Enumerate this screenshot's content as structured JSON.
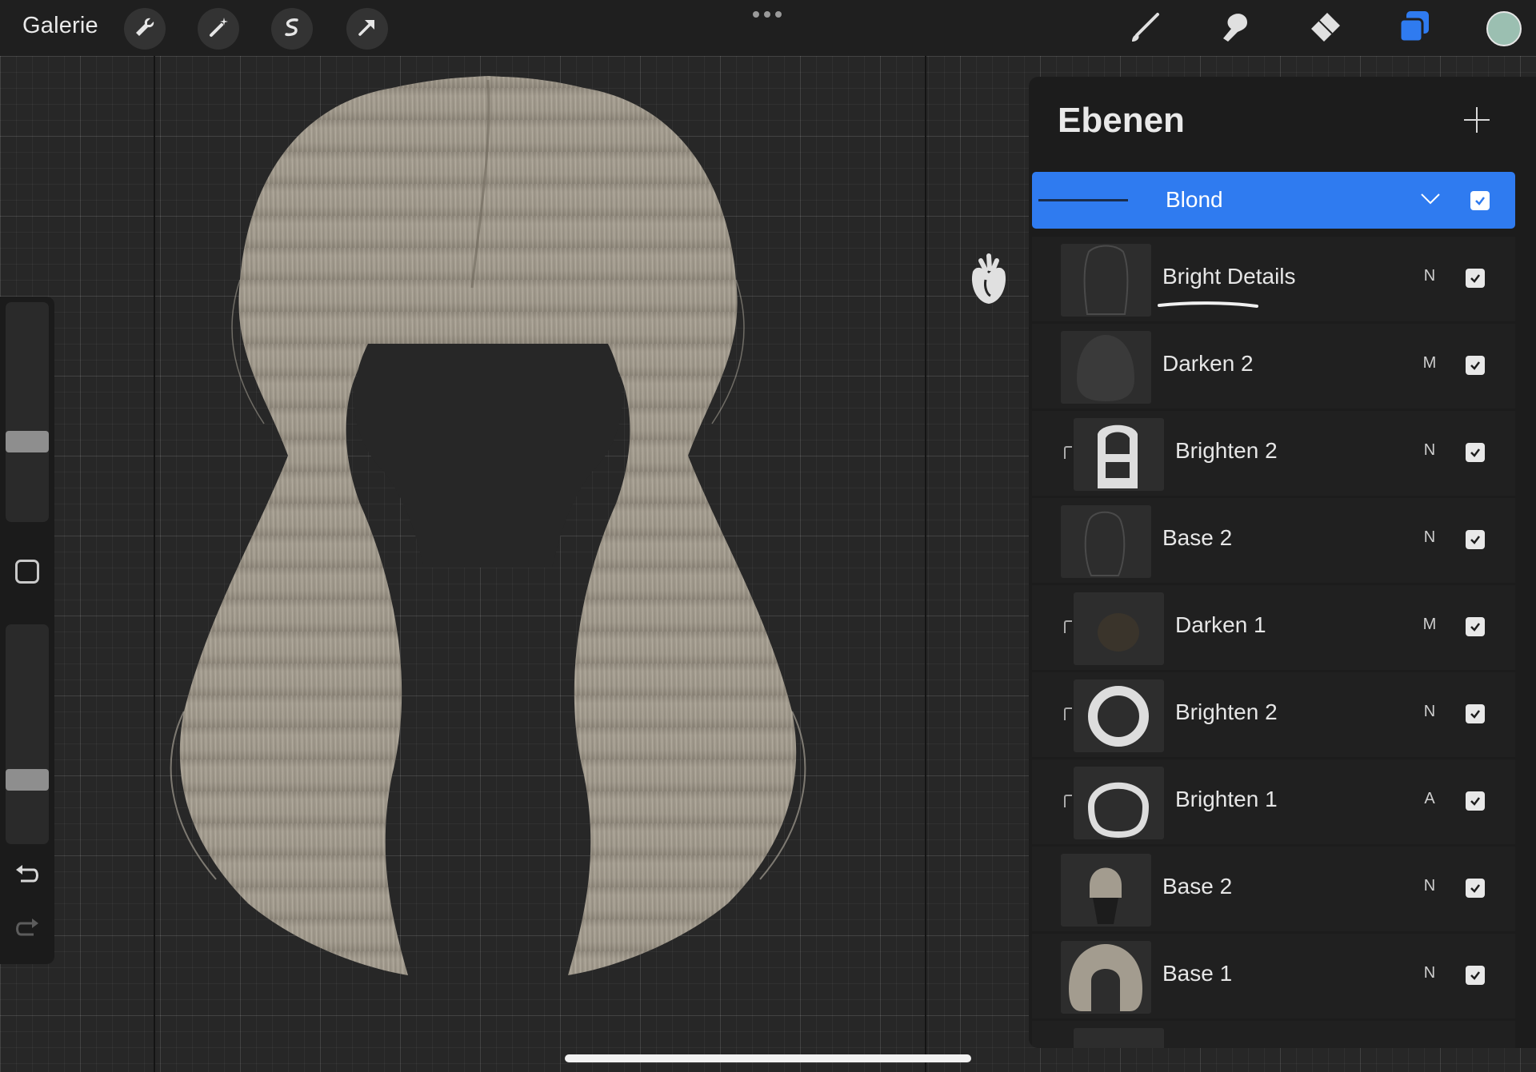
{
  "topbar": {
    "gallery_label": "Galerie",
    "left_tools": [
      "wrench-icon",
      "magic-wand-icon",
      "selection-icon",
      "transform-arrow-icon"
    ],
    "right_tools": [
      "brush-icon",
      "smudge-icon",
      "eraser-icon",
      "layers-icon"
    ],
    "active_tool": "layers-icon",
    "accent_color": "#2f7bf0",
    "current_color": "#9bbfb1"
  },
  "sidebar": {
    "brush_size_level": 0.35,
    "opacity_level": 0.27
  },
  "layers_panel": {
    "title": "Ebenen",
    "group": {
      "name": "Blond",
      "visible": true
    },
    "layers": [
      {
        "name": "Bright Details",
        "mode": "N",
        "visible": true,
        "clipped": false
      },
      {
        "name": "Darken 2",
        "mode": "M",
        "visible": true,
        "clipped": false
      },
      {
        "name": "Brighten 2",
        "mode": "N",
        "visible": true,
        "clipped": true
      },
      {
        "name": "Base 2",
        "mode": "N",
        "visible": true,
        "clipped": false
      },
      {
        "name": "Darken 1",
        "mode": "M",
        "visible": true,
        "clipped": true
      },
      {
        "name": "Brighten 2",
        "mode": "N",
        "visible": true,
        "clipped": true
      },
      {
        "name": "Brighten 1",
        "mode": "A",
        "visible": true,
        "clipped": true
      },
      {
        "name": "Base 2",
        "mode": "N",
        "visible": true,
        "clipped": false
      },
      {
        "name": "Base 1",
        "mode": "N",
        "visible": true,
        "clipped": false
      }
    ]
  }
}
